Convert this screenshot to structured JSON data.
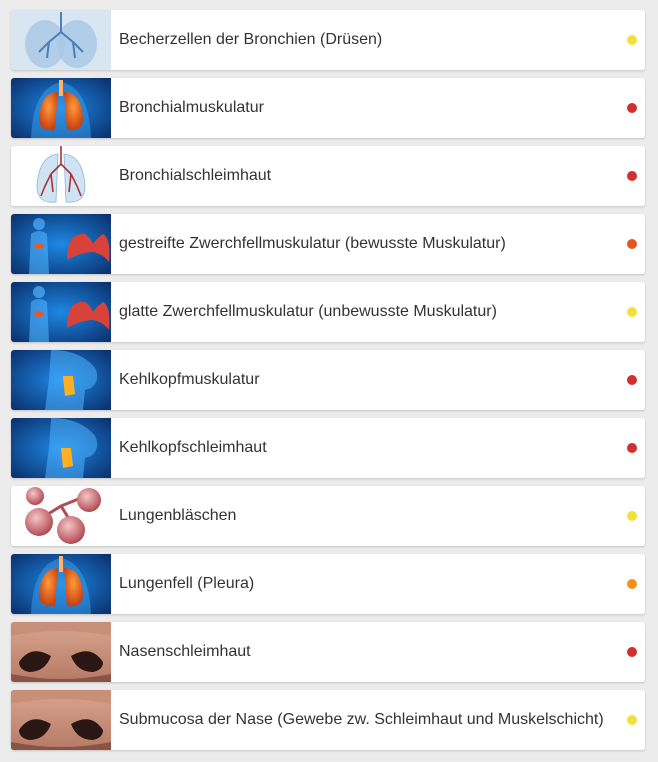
{
  "items": [
    {
      "label": "Becherzellen der Bronchien (Drüsen)",
      "status_color": "#f2e03a",
      "image": "bronchi-xray-image"
    },
    {
      "label": "Bronchialmuskulatur",
      "status_color": "#d32f2f",
      "image": "lungs-torso-image"
    },
    {
      "label": "Bronchialschleimhaut",
      "status_color": "#d32f2f",
      "image": "bronchial-tree-image"
    },
    {
      "label": "gestreifte Zwerchfellmuskulatur (bewusste Muskulatur)",
      "status_color": "#e2571e",
      "image": "diaphragm-image"
    },
    {
      "label": "glatte Zwerchfellmuskulatur (unbewusste Muskulatur)",
      "status_color": "#f2e03a",
      "image": "diaphragm-image"
    },
    {
      "label": "Kehlkopfmuskulatur",
      "status_color": "#d32f2f",
      "image": "larynx-neck-image"
    },
    {
      "label": "Kehlkopfschleimhaut",
      "status_color": "#d32f2f",
      "image": "larynx-neck-image"
    },
    {
      "label": "Lungenbläschen",
      "status_color": "#f2e03a",
      "image": "alveoli-image"
    },
    {
      "label": "Lungenfell (Pleura)",
      "status_color": "#f39214",
      "image": "lungs-torso-image"
    },
    {
      "label": "Nasenschleimhaut",
      "status_color": "#d32f2f",
      "image": "nose-photo-image"
    },
    {
      "label": "Submucosa der Nase (Gewebe zw. Schleimhaut und Muskelschicht)",
      "status_color": "#f2e03a",
      "image": "nose-photo-image"
    }
  ]
}
